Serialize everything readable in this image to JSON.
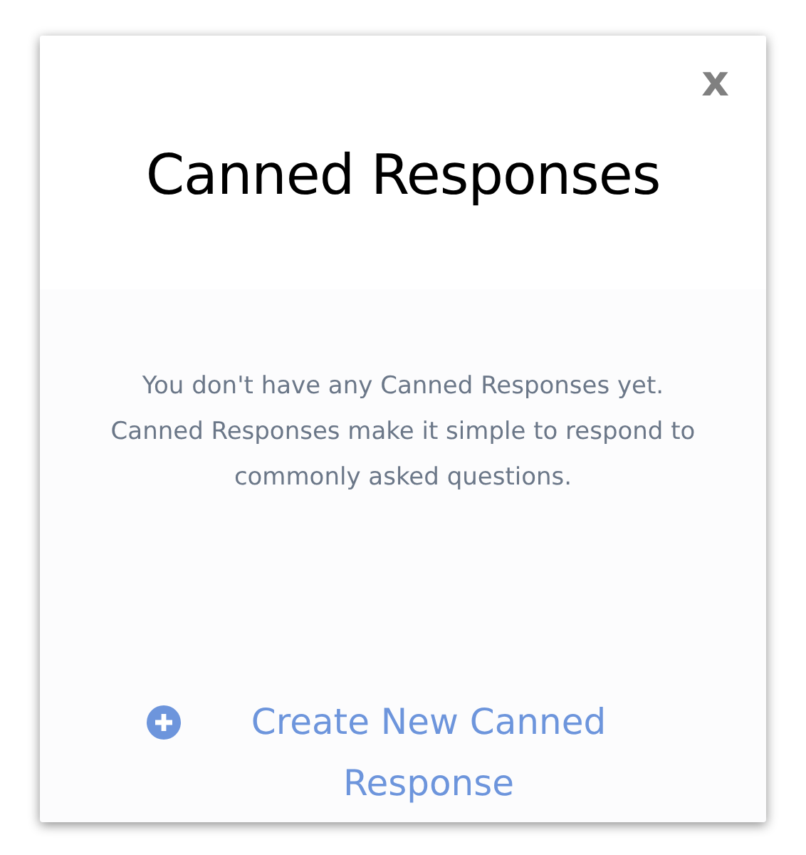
{
  "dialog": {
    "close": "x",
    "title": "Canned Responses",
    "message": "You don't have any Canned Responses yet. Canned Responses make it simple to respond to commonly asked questions.",
    "action": "Create New Canned Response"
  }
}
